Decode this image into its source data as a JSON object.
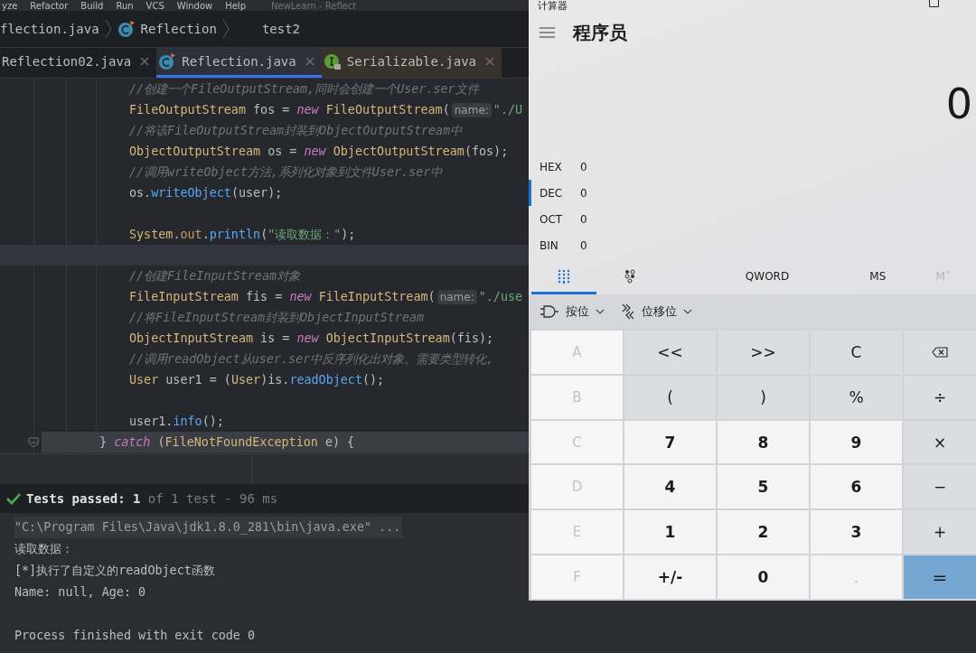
{
  "ide": {
    "menu": [
      "yze",
      "Refactor",
      "Build",
      "Run",
      "VCS",
      "Window",
      "Help"
    ],
    "title": "NewLearn - Reflect",
    "breadcrumbs": [
      {
        "label": "flection.java",
        "kind": "file"
      },
      {
        "label": "Reflection",
        "kind": "class"
      },
      {
        "label": "test2",
        "kind": "method"
      }
    ],
    "tabs": [
      {
        "label": "Reflection02.java",
        "kind": "plain",
        "selected": false
      },
      {
        "label": "Reflection.java",
        "kind": "class",
        "selected": true
      },
      {
        "label": "Serializable.java",
        "kind": "interface",
        "selected": false
      }
    ],
    "code": [
      {
        "kind": "inner",
        "highlighted": false,
        "tokens": [
          {
            "kind": "comment",
            "text": "//创建一个FileOutputStream,同时会创建一个User.ser文件"
          }
        ]
      },
      {
        "kind": "inner",
        "highlighted": false,
        "tokens": [
          {
            "kind": "type",
            "text": "FileOutputStream"
          },
          {
            "kind": "plain",
            "text": " fos = "
          },
          {
            "kind": "keyword",
            "text": "new "
          },
          {
            "kind": "type",
            "text": "FileOutputStream"
          },
          {
            "kind": "plain",
            "text": "("
          },
          {
            "kind": "hint",
            "text": "name:"
          },
          {
            "kind": "string",
            "text": "\"./U"
          }
        ]
      },
      {
        "kind": "inner",
        "highlighted": false,
        "tokens": [
          {
            "kind": "comment",
            "text": "//将该FileOutputStream封装到ObjectOutputStream中"
          }
        ]
      },
      {
        "kind": "inner",
        "highlighted": false,
        "tokens": [
          {
            "kind": "type",
            "text": "ObjectOutputStream"
          },
          {
            "kind": "plain",
            "text": " os = "
          },
          {
            "kind": "keyword",
            "text": "new "
          },
          {
            "kind": "type",
            "text": "ObjectOutputStream"
          },
          {
            "kind": "plain",
            "text": "(fos);"
          }
        ]
      },
      {
        "kind": "inner",
        "highlighted": false,
        "tokens": [
          {
            "kind": "comment",
            "text": "//调用writeObject方法,系列化对象到文件User.ser中"
          }
        ]
      },
      {
        "kind": "inner",
        "highlighted": false,
        "tokens": [
          {
            "kind": "plain",
            "text": "os."
          },
          {
            "kind": "method",
            "text": "writeObject"
          },
          {
            "kind": "plain",
            "text": "(user);"
          }
        ]
      },
      {
        "kind": "blank"
      },
      {
        "kind": "inner",
        "highlighted": false,
        "tokens": [
          {
            "kind": "type",
            "text": "System"
          },
          {
            "kind": "plain",
            "text": "."
          },
          {
            "kind": "field",
            "text": "out"
          },
          {
            "kind": "plain",
            "text": "."
          },
          {
            "kind": "method",
            "text": "println"
          },
          {
            "kind": "plain",
            "text": "("
          },
          {
            "kind": "string",
            "text": "\"读取数据：\""
          },
          {
            "kind": "plain",
            "text": ");"
          }
        ]
      },
      {
        "kind": "current"
      },
      {
        "kind": "inner",
        "highlighted": false,
        "tokens": [
          {
            "kind": "comment",
            "text": "//创建FileInputStream对象"
          }
        ]
      },
      {
        "kind": "inner",
        "highlighted": false,
        "tokens": [
          {
            "kind": "type",
            "text": "FileInputStream"
          },
          {
            "kind": "plain",
            "text": " fis = "
          },
          {
            "kind": "keyword",
            "text": "new "
          },
          {
            "kind": "type",
            "text": "FileInputStream"
          },
          {
            "kind": "plain",
            "text": "("
          },
          {
            "kind": "hint",
            "text": "name:"
          },
          {
            "kind": "string",
            "text": "\"./use"
          }
        ]
      },
      {
        "kind": "inner",
        "highlighted": false,
        "tokens": [
          {
            "kind": "comment",
            "text": "//将FileInputStream封装到ObjectInputStream"
          }
        ]
      },
      {
        "kind": "inner",
        "highlighted": false,
        "tokens": [
          {
            "kind": "type",
            "text": "ObjectInputStream"
          },
          {
            "kind": "plain",
            "text": " is = "
          },
          {
            "kind": "keyword",
            "text": "new "
          },
          {
            "kind": "type",
            "text": "ObjectInputStream"
          },
          {
            "kind": "plain",
            "text": "(fis);"
          }
        ]
      },
      {
        "kind": "inner",
        "highlighted": false,
        "tokens": [
          {
            "kind": "comment",
            "text": "//调用readObject从user.ser中反序列化出对象。需要类型转化,"
          }
        ]
      },
      {
        "kind": "inner",
        "highlighted": false,
        "tokens": [
          {
            "kind": "type",
            "text": "User"
          },
          {
            "kind": "plain",
            "text": " user1 = ("
          },
          {
            "kind": "type",
            "text": "User"
          },
          {
            "kind": "plain",
            "text": ")is."
          },
          {
            "kind": "method",
            "text": "readObject"
          },
          {
            "kind": "plain",
            "text": "();"
          }
        ]
      },
      {
        "kind": "blank"
      },
      {
        "kind": "inner",
        "highlighted": false,
        "tokens": [
          {
            "kind": "plain",
            "text": "user1."
          },
          {
            "kind": "method",
            "text": "info"
          },
          {
            "kind": "plain",
            "text": "();"
          }
        ]
      },
      {
        "kind": "outer",
        "highlighted": true,
        "fold": true,
        "tokens": [
          {
            "kind": "plain",
            "text": "} "
          },
          {
            "kind": "keyword",
            "text": "catch"
          },
          {
            "kind": "plain",
            "text": " ("
          },
          {
            "kind": "type",
            "text": "FileNotFoundException"
          },
          {
            "kind": "plain",
            "text": " e) {"
          }
        ]
      }
    ],
    "tests": {
      "passed": true,
      "summary": "**Tests passed: 1** of 1 test - 96 ms"
    },
    "console": [
      {
        "kind": "command",
        "text": "\"C:\\Program Files\\Java\\jdk1.8.0_281\\bin\\java.exe\" ..."
      },
      {
        "kind": "output",
        "text": "读取数据："
      },
      {
        "kind": "output",
        "text": "[*]执行了自定义的readObject函数"
      },
      {
        "kind": "output",
        "text": "Name: null, Age: 0"
      },
      {
        "kind": "blank"
      },
      {
        "kind": "output",
        "text": "Process finished with exit code 0"
      }
    ]
  },
  "calculator": {
    "title": "计算器",
    "mode": "程序员",
    "display": "0",
    "radix": [
      {
        "label": "HEX",
        "value": "0",
        "selected": false
      },
      {
        "label": "DEC",
        "value": "0",
        "selected": true
      },
      {
        "label": "OCT",
        "value": "0",
        "selected": false
      },
      {
        "label": "BIN",
        "value": "0",
        "selected": false
      }
    ],
    "toolbar": [
      {
        "kind": "keypad",
        "selected": true,
        "disabled": false
      },
      {
        "kind": "bits",
        "selected": false,
        "disabled": false
      },
      {
        "kind": "word",
        "label": "QWORD",
        "selected": false,
        "disabled": false
      },
      {
        "kind": "memory",
        "label": "MS",
        "selected": false,
        "disabled": false
      },
      {
        "kind": "memory",
        "label": "M˅",
        "selected": false,
        "disabled": true
      }
    ],
    "dropdowns": [
      {
        "kind": "bitwise",
        "label": "按位"
      },
      {
        "kind": "shift",
        "label": "位移位"
      }
    ],
    "keys": [
      {
        "kind": "hex",
        "label": "A",
        "disabled": true
      },
      {
        "kind": "op",
        "label": "<<",
        "disabled": false
      },
      {
        "kind": "op",
        "label": ">>",
        "disabled": false
      },
      {
        "kind": "op",
        "label": "C",
        "disabled": false
      },
      {
        "kind": "backspace",
        "disabled": false
      },
      {
        "kind": "hex",
        "label": "B",
        "disabled": true
      },
      {
        "kind": "op",
        "label": "(",
        "disabled": false
      },
      {
        "kind": "op",
        "label": ")",
        "disabled": false
      },
      {
        "kind": "op",
        "label": "%",
        "disabled": false
      },
      {
        "kind": "op",
        "label": "÷",
        "disabled": false
      },
      {
        "kind": "hex",
        "label": "C",
        "disabled": true
      },
      {
        "kind": "digit",
        "label": "7",
        "disabled": false
      },
      {
        "kind": "digit",
        "label": "8",
        "disabled": false
      },
      {
        "kind": "digit",
        "label": "9",
        "disabled": false
      },
      {
        "kind": "op",
        "label": "×",
        "disabled": false
      },
      {
        "kind": "hex",
        "label": "D",
        "disabled": true
      },
      {
        "kind": "digit",
        "label": "4",
        "disabled": false
      },
      {
        "kind": "digit",
        "label": "5",
        "disabled": false
      },
      {
        "kind": "digit",
        "label": "6",
        "disabled": false
      },
      {
        "kind": "op",
        "label": "−",
        "disabled": false
      },
      {
        "kind": "hex",
        "label": "E",
        "disabled": true
      },
      {
        "kind": "digit",
        "label": "1",
        "disabled": false
      },
      {
        "kind": "digit",
        "label": "2",
        "disabled": false
      },
      {
        "kind": "digit",
        "label": "3",
        "disabled": false
      },
      {
        "kind": "op",
        "label": "+",
        "disabled": false
      },
      {
        "kind": "hex",
        "label": "F",
        "disabled": true
      },
      {
        "kind": "digit",
        "label": "+/-",
        "disabled": false
      },
      {
        "kind": "digit",
        "label": "0",
        "disabled": false
      },
      {
        "kind": "digit",
        "label": ".",
        "disabled": true
      },
      {
        "kind": "equals",
        "label": "=",
        "disabled": false
      }
    ]
  }
}
